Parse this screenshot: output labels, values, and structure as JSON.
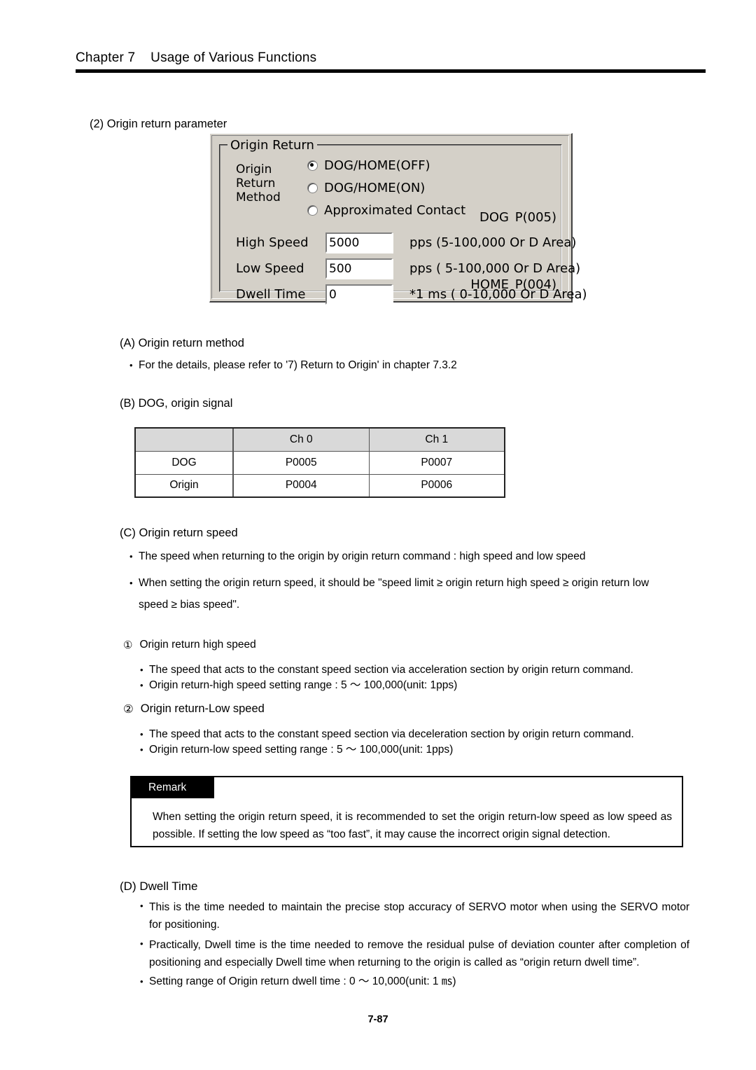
{
  "header": {
    "chapter": "Chapter 7",
    "title": "Usage of Various Functions",
    "combined": "Chapter 7    Usage of Various Functions"
  },
  "section": {
    "number_label": "(2) Origin return parameter"
  },
  "dialog": {
    "group_title": "Origin Return",
    "method_label": "Origin\nReturn\nMethod",
    "radios": [
      {
        "label": "DOG/HOME(OFF)",
        "checked": true
      },
      {
        "label": "DOG/HOME(ON)",
        "checked": false
      },
      {
        "label": "Approximated Contact",
        "checked": false
      }
    ],
    "signals": [
      {
        "name": "DOG",
        "value": "P(005)"
      },
      {
        "name": "HOME",
        "value": "P(004)"
      }
    ],
    "fields": [
      {
        "label": "High Speed",
        "value": "5000",
        "unit": "pps (5-100,000 Or D Area)"
      },
      {
        "label": "Low Speed",
        "value": "500",
        "unit": "pps ( 5-100,000 Or D Area)"
      },
      {
        "label": "Dwell Time",
        "value": "0",
        "unit": "*1 ms ( 0-10,000 Or D Area)"
      }
    ]
  },
  "sectionA": {
    "heading": "(A) Origin return method",
    "bullets": [
      "For the details, please refer to '7) Return to Origin' in chapter 7.3.2"
    ]
  },
  "sectionB": {
    "heading": "(B) DOG, origin signal",
    "table": {
      "columns": [
        "",
        "Ch 0",
        "Ch 1"
      ],
      "rows": [
        [
          "DOG",
          "P0005",
          "P0007"
        ],
        [
          "Origin",
          "P0004",
          "P0006"
        ]
      ]
    }
  },
  "sectionC": {
    "heading": "(C) Origin return speed",
    "bullets": [
      "The speed when returning to the origin by origin return command : high speed and low speed",
      "When setting the origin return speed, it should be \"speed limit ≥ origin return high speed ≥ origin return low speed ≥ bias speed\"."
    ],
    "sub1": {
      "marker": "①",
      "heading": "Origin return high speed",
      "bullets": [
        "The speed that acts to the constant speed section via acceleration section by origin return command.",
        "Origin return-high speed setting range : 5  ～  100,000(unit: 1pps)"
      ]
    },
    "sub2": {
      "marker": "②",
      "heading": "Origin return-Low speed",
      "bullets": [
        "The speed that acts to the constant speed section via deceleration section by origin return command.",
        "Origin return-low speed setting range : 5  ～  100,000(unit: 1pps)"
      ]
    }
  },
  "remark": {
    "tab_label": "Remark",
    "text": "When setting the origin return speed, it is recommended to set the origin return-low speed as low speed as possible. If setting the low speed as “too fast”, it may cause the incorrect origin signal detection."
  },
  "sectionD": {
    "heading": "(D) Dwell Time",
    "bullets": [
      "This is the time needed to maintain the precise stop accuracy of SERVO motor when using the SERVO motor for positioning.",
      "Practically, Dwell time is the time needed to remove the residual pulse of deviation counter after completion of positioning and especially Dwell time when returning to the origin is called as “origin return dwell time”.",
      "Setting range of Origin return dwell time :   0  ～  10,000(unit: 1 ㎳)"
    ]
  },
  "footer": {
    "page_number": "7-87"
  }
}
